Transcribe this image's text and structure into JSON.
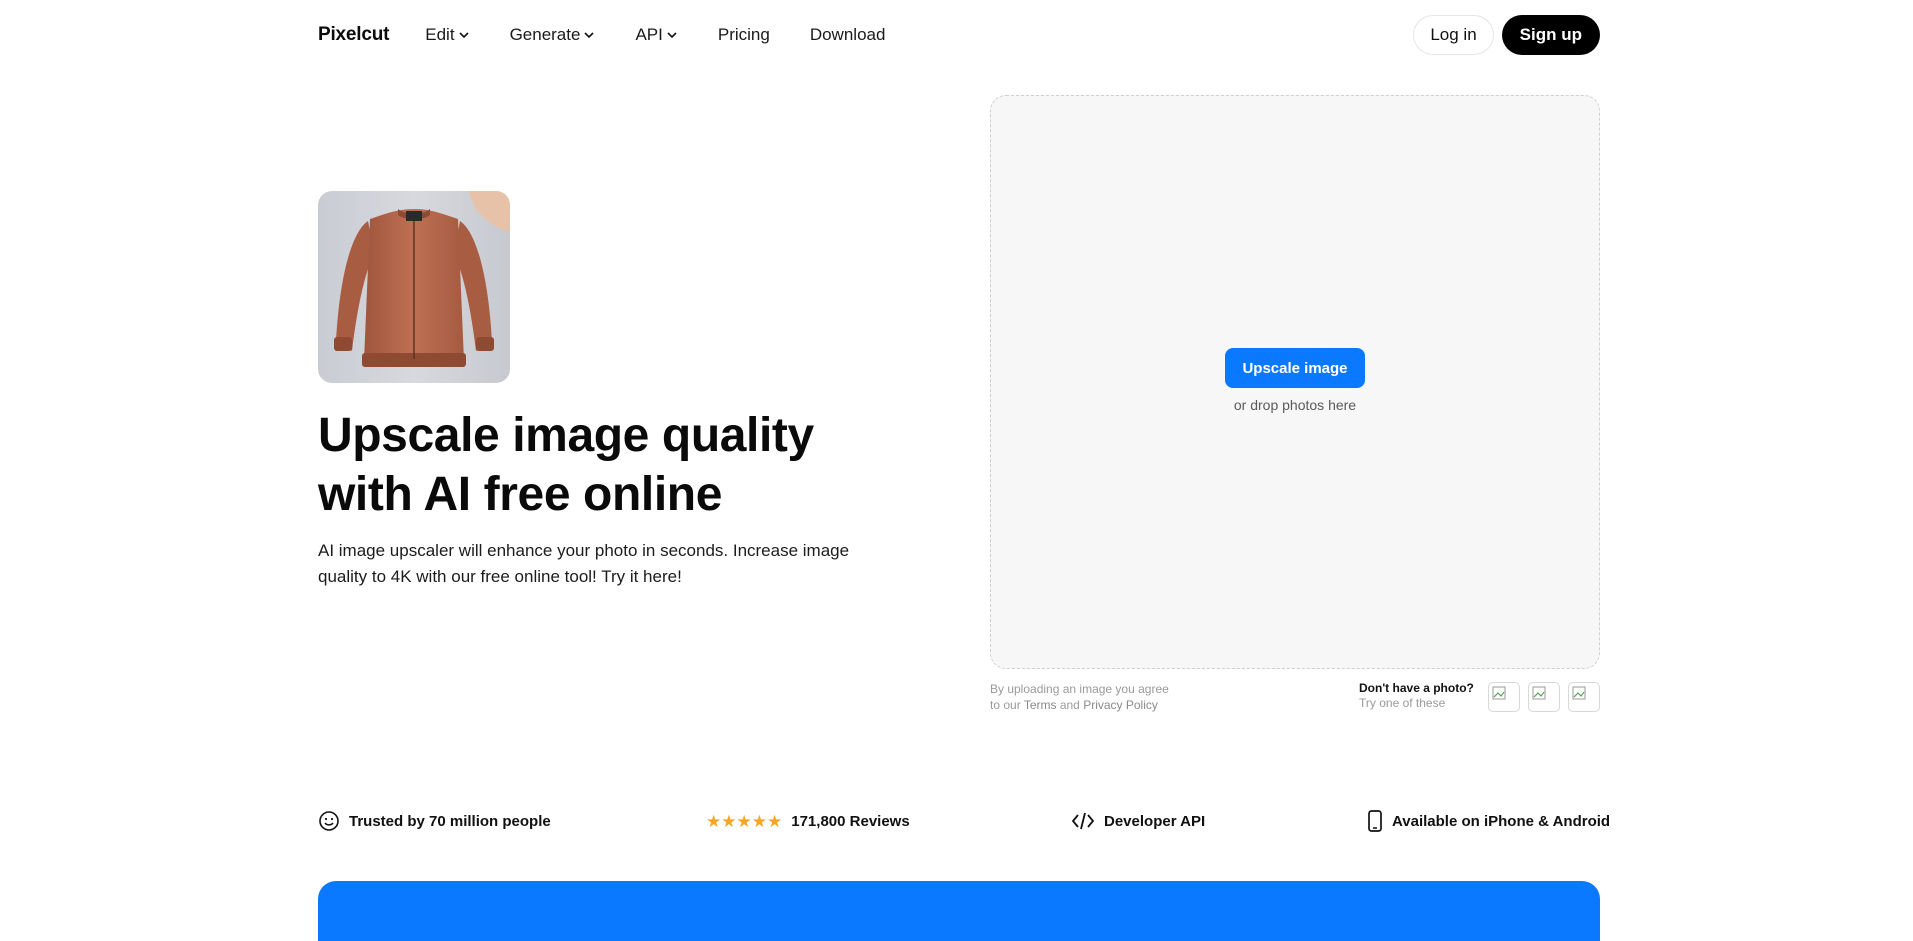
{
  "nav": {
    "logo": "Pixelcut",
    "items": [
      {
        "label": "Edit",
        "dropdown": true
      },
      {
        "label": "Generate",
        "dropdown": true
      },
      {
        "label": "API",
        "dropdown": true
      },
      {
        "label": "Pricing",
        "dropdown": false
      },
      {
        "label": "Download",
        "dropdown": false
      }
    ],
    "login": "Log in",
    "signup": "Sign up"
  },
  "hero": {
    "title": "Upscale image quality with AI free online",
    "subtitle": "AI image upscaler will enhance your photo in seconds. Increase image quality to 4K with our free online tool! Try it here!"
  },
  "upload": {
    "button": "Upscale image",
    "hint": "or drop photos here",
    "legal_line1": "By uploading an image you agree",
    "legal_prefix": "to our ",
    "terms": "Terms",
    "and": " and ",
    "privacy": "Privacy Policy",
    "samples_question": "Don't have a photo?",
    "samples_hint": "Try one of these"
  },
  "trust": {
    "people": "Trusted by 70 million people",
    "reviews": "171,800 Reviews",
    "api": "Developer API",
    "mobile": "Available on iPhone & Android",
    "rating_stars": 5
  },
  "colors": {
    "accent": "#0a79ff",
    "star": "#f6a623",
    "jacket": "#b8694d"
  }
}
